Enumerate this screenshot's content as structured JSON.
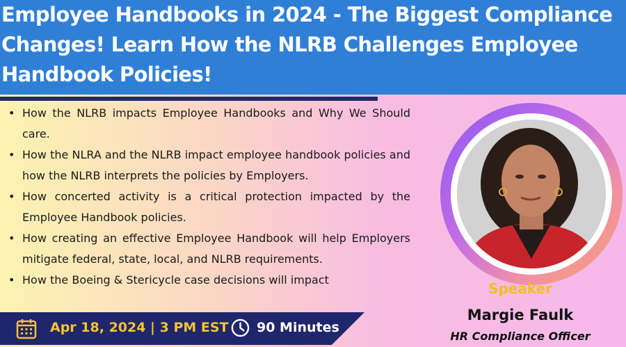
{
  "header": {
    "title": "Employee Handbooks in 2024 - The Biggest Compliance Changes! Learn How the NLRB Challenges Employee Handbook Policies!"
  },
  "bullets": [
    "How the NLRB impacts Employee Handbooks and Why We Should care.",
    "How the NLRA and the NLRB impact employee handbook policies and how the NLRB interprets the policies by Employers.",
    "How concerted activity is a critical protection impacted by the Employee Handbook policies.",
    "How creating an effective Employee Handbook will help Employers mitigate federal, state, local, and NLRB requirements.",
    "How the Boeing & Stericycle case decisions will impact"
  ],
  "speaker": {
    "label": "Speaker",
    "name": "Margie Faulk",
    "role": "HR Compliance Officer"
  },
  "event": {
    "date": "Apr 18, 2024 | 3 PM EST",
    "duration": "90 Minutes",
    "calendar_icon": "calendar-icon",
    "clock_icon": "clock-icon"
  },
  "colors": {
    "header_bg": "#2f7fd6",
    "bar_bg": "#20266b",
    "accent_yellow": "#f4c430"
  }
}
